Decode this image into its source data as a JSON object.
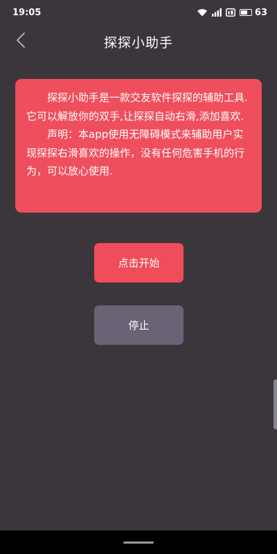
{
  "status_bar": {
    "time": "19:05",
    "battery": "63",
    "battery_level": 0.63,
    "icons": [
      "wifi-icon",
      "signal-icon",
      "hd-icon",
      "battery-icon"
    ]
  },
  "header": {
    "title": "探探小助手",
    "back_icon": "chevron-left-icon"
  },
  "info_card": {
    "paragraph1": "探探小助手是一款交友软件探探的辅助工具.它可以解放你的双手,让探探自动右滑,添加喜欢.",
    "paragraph2": "声明：本app使用无障碍模式来辅助用户实现探探右滑喜欢的操作，没有任何危害手机的行为，可以放心使用."
  },
  "buttons": {
    "start_label": "点击开始",
    "stop_label": "停止"
  },
  "colors": {
    "background": "#3a363c",
    "accent": "#ee4d59",
    "stop_button": "#6b6276"
  }
}
